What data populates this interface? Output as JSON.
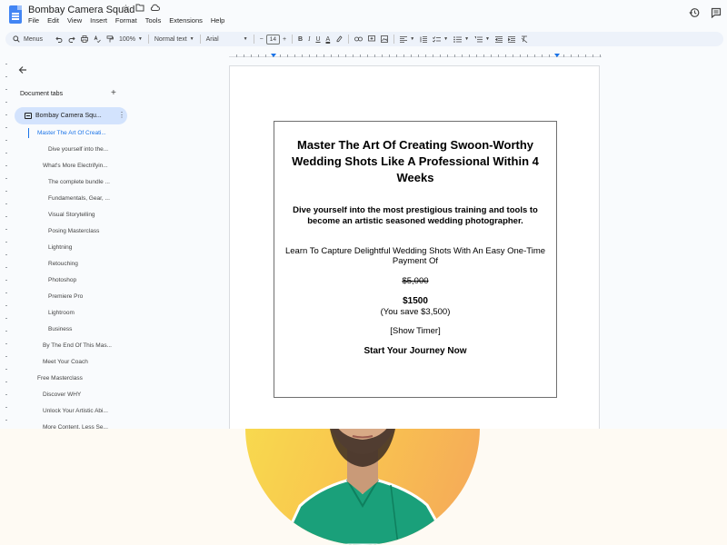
{
  "app": {
    "doc_title": "Bombay Camera Squad",
    "menu": [
      "File",
      "Edit",
      "View",
      "Insert",
      "Format",
      "Tools",
      "Extensions",
      "Help"
    ]
  },
  "toolbar": {
    "menus_label": "Menus",
    "zoom": "100%",
    "style": "Normal text",
    "font": "Arial",
    "font_size": "14",
    "minus": "−",
    "plus": "+",
    "bold": "B",
    "italic": "I",
    "underline": "U",
    "text_color": "A"
  },
  "sidebar": {
    "tabs_label": "Document tabs",
    "add_label": "+",
    "active_tab": "Bombay Camera Squ...",
    "outline": [
      {
        "label": "Master The Art Of Creati...",
        "level": 1,
        "selected": true
      },
      {
        "label": "Dive yourself into the...",
        "level": 3,
        "selected": false
      },
      {
        "label": "What's More Electrifyin...",
        "level": 2,
        "selected": false
      },
      {
        "label": "The complete bundle ...",
        "level": 3,
        "selected": false
      },
      {
        "label": "Fundamentals, Gear, ...",
        "level": 3,
        "selected": false
      },
      {
        "label": "Visual Storytelling",
        "level": 3,
        "selected": false
      },
      {
        "label": "Posing Masterclass",
        "level": 3,
        "selected": false
      },
      {
        "label": "Lightning",
        "level": 3,
        "selected": false
      },
      {
        "label": "Retouching",
        "level": 3,
        "selected": false
      },
      {
        "label": "Photoshop",
        "level": 3,
        "selected": false
      },
      {
        "label": "Premiere Pro",
        "level": 3,
        "selected": false
      },
      {
        "label": "Lightroom",
        "level": 3,
        "selected": false
      },
      {
        "label": "Business",
        "level": 3,
        "selected": false
      },
      {
        "label": "By The End Of This Mas...",
        "level": 2,
        "selected": false
      },
      {
        "label": "Meet Your Coach",
        "level": 2,
        "selected": false
      },
      {
        "label": "Free Masterclass",
        "level": 1,
        "selected": false
      },
      {
        "label": "Discover WHY",
        "level": 2,
        "selected": false
      },
      {
        "label": "Unlock Your Artistic Abi...",
        "level": 2,
        "selected": false
      },
      {
        "label": "More Content, Less Se...",
        "level": 2,
        "selected": false
      }
    ]
  },
  "document": {
    "heading": "Master The Art Of Creating Swoon-Worthy Wedding Shots Like A Professional Within 4 Weeks",
    "subheading": "Dive yourself into the most prestigious training and tools to become an artistic seasoned wedding photographer.",
    "capture_text": "Learn To Capture Delightful Wedding Shots With An Easy One-Time Payment Of",
    "old_price": "$5,000",
    "new_price": "$1500",
    "save_note": "(You save $3,500)",
    "timer": "[Show Timer]",
    "cta": "Start Your Journey Now"
  }
}
